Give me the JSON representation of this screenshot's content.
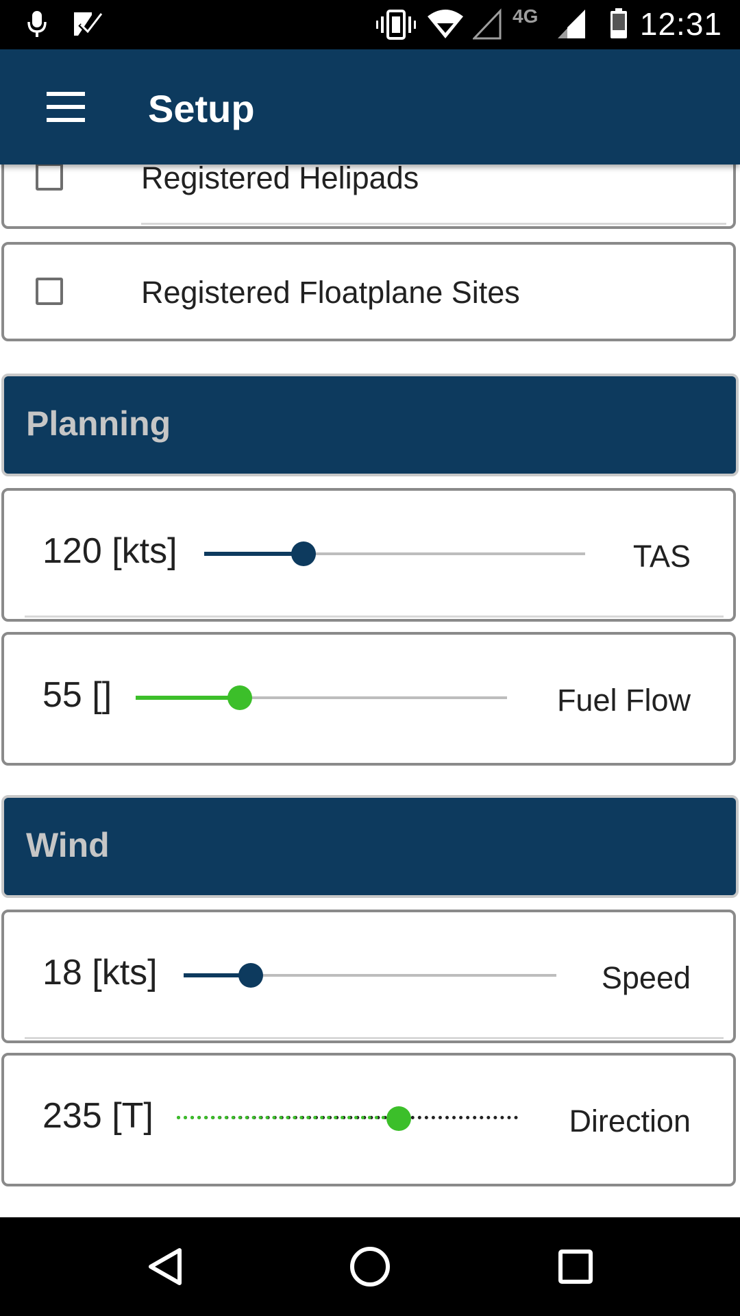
{
  "status_bar": {
    "time": "12:31",
    "network": "4G",
    "icons": [
      "mic-icon",
      "check-notification-icon",
      "vibrate-icon",
      "wifi-icon",
      "signal-empty-icon",
      "signal-icon",
      "battery-icon"
    ]
  },
  "app_bar": {
    "title": "Setup",
    "menu_icon": "hamburger-menu-icon"
  },
  "checkbox_items": [
    {
      "label": "Registered Helipads",
      "checked": false
    },
    {
      "label": "Registered Floatplane Sites",
      "checked": false
    }
  ],
  "sections": {
    "planning": {
      "title": "Planning",
      "sliders": [
        {
          "value_text": "120 [kts]",
          "name": "TAS",
          "fraction": 0.26,
          "color": "#0d3a5e",
          "style": "solid"
        },
        {
          "value_text": "55 []",
          "name": "Fuel Flow",
          "fraction": 0.28,
          "color": "#3cbf2a",
          "style": "solid"
        }
      ]
    },
    "wind": {
      "title": "Wind",
      "sliders": [
        {
          "value_text": "18 [kts]",
          "name": "Speed",
          "fraction": 0.18,
          "color": "#0d3a5e",
          "style": "solid"
        },
        {
          "value_text": "235 [T]",
          "name": "Direction",
          "fraction": 0.65,
          "color": "#3cbf2a",
          "style": "dotted"
        }
      ]
    }
  },
  "colors": {
    "primary": "#0d3a5e",
    "accent_green": "#3cbf2a",
    "section_title": "#c6c6c6"
  },
  "nav_bar": {
    "icons": [
      "back-icon",
      "home-icon",
      "recents-icon"
    ]
  }
}
